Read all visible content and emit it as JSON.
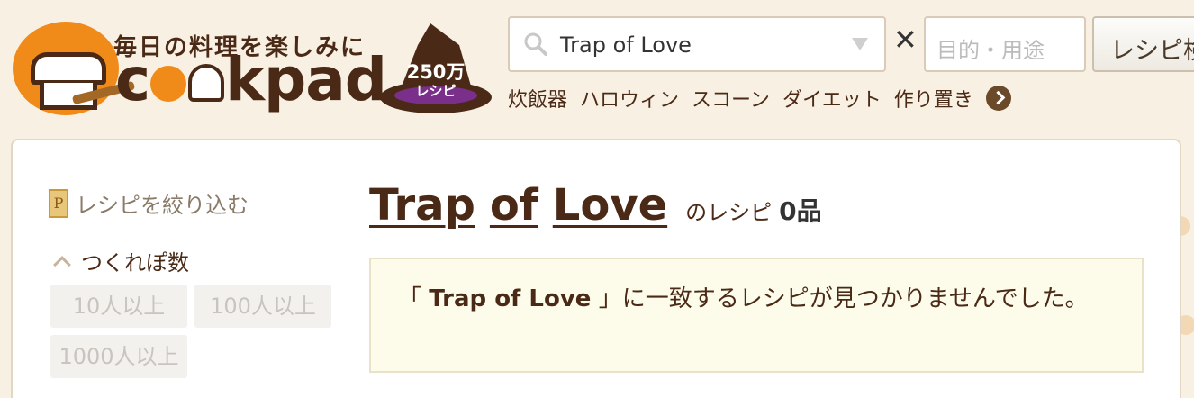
{
  "header": {
    "tagline": "毎日の料理を楽しみに",
    "wordmark_prefix": "c",
    "wordmark_suffix": "kpad",
    "hat_count": "250万",
    "hat_unit": "レシピ",
    "search": {
      "value": "Trap of Love",
      "purpose_placeholder": "目的・用途",
      "button_label": "レシピ検索"
    },
    "keywords": [
      "炊飯器",
      "ハロウィン",
      "スコーン",
      "ダイエット",
      "作り置き"
    ]
  },
  "sidebar": {
    "filter_label": "レシピを絞り込む",
    "tsukurepo_label": "つくれぽ数",
    "count_options": [
      "10人以上",
      "100人以上",
      "1000人以上"
    ]
  },
  "results": {
    "query_words": [
      "Trap",
      "of",
      "Love"
    ],
    "title_suffix": "のレシピ",
    "count": "0品",
    "notice_open": "「",
    "notice_query": "Trap of Love",
    "notice_close": "」に一致するレシピが見つかりませんでした。"
  },
  "colors": {
    "background": "#f8f0e3",
    "brand_orange": "#f08a19",
    "brand_brown": "#4a2a16",
    "notice_bg": "#fdfbea"
  }
}
